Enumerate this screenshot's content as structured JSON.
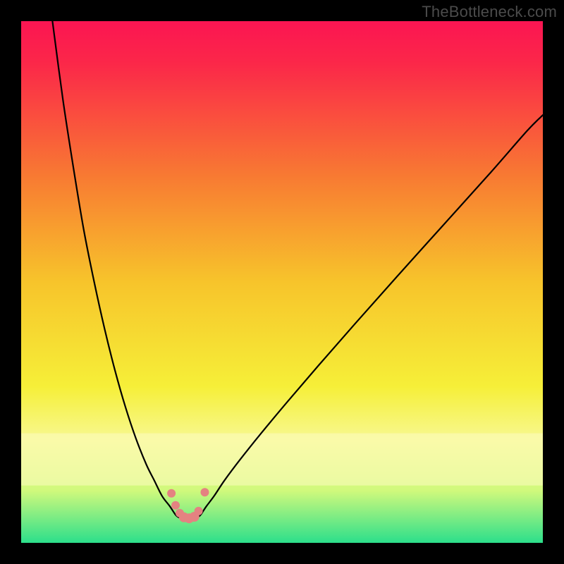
{
  "watermark": "TheBottleneck.com",
  "chart_data": {
    "type": "line",
    "title": "",
    "xlabel": "",
    "ylabel": "",
    "xlim": [
      0,
      100
    ],
    "ylim": [
      0,
      100
    ],
    "grid": false,
    "legend": false,
    "background_gradient": {
      "stops": [
        {
          "offset": 0.0,
          "color": "#fb1552"
        },
        {
          "offset": 0.08,
          "color": "#fb2749"
        },
        {
          "offset": 0.3,
          "color": "#f87b32"
        },
        {
          "offset": 0.5,
          "color": "#f7c42b"
        },
        {
          "offset": 0.7,
          "color": "#f6ef38"
        },
        {
          "offset": 0.8,
          "color": "#f7f88e"
        },
        {
          "offset": 0.9,
          "color": "#d0f97c"
        },
        {
          "offset": 1.0,
          "color": "#2cdf8b"
        }
      ]
    },
    "pale_band": {
      "y0": 79,
      "y1": 89,
      "color": "#fdfcbf"
    },
    "series": [
      {
        "name": "left-arm",
        "type": "line",
        "x": [
          6,
          8,
          10,
          12,
          14,
          16,
          18,
          20,
          22,
          24,
          25.5,
          27,
          28.5,
          29.5,
          30,
          30.5
        ],
        "y": [
          0,
          15,
          28,
          40,
          50,
          59,
          67,
          74,
          80,
          85,
          88,
          91,
          93,
          94.5,
          95,
          95.2
        ]
      },
      {
        "name": "right-arm",
        "type": "line",
        "x": [
          33.5,
          34,
          34.5,
          35.5,
          37,
          39,
          42,
          46,
          51,
          57,
          64,
          72,
          81,
          90,
          97,
          100
        ],
        "y": [
          95.2,
          95,
          94.5,
          93,
          91,
          88,
          84,
          79,
          73,
          66,
          58,
          49,
          39,
          29,
          21,
          18
        ]
      },
      {
        "name": "valley-floor",
        "type": "line",
        "x": [
          30.5,
          31,
          31.8,
          32.6,
          33.2,
          33.5
        ],
        "y": [
          95.2,
          95.4,
          95.5,
          95.5,
          95.4,
          95.2
        ]
      }
    ],
    "markers": {
      "name": "valley-dots",
      "color": "#e48281",
      "points": [
        {
          "x": 28.8,
          "y": 90.5,
          "r": 6
        },
        {
          "x": 29.6,
          "y": 92.8,
          "r": 6
        },
        {
          "x": 30.4,
          "y": 94.3,
          "r": 6
        },
        {
          "x": 31.2,
          "y": 95.1,
          "r": 7
        },
        {
          "x": 32.2,
          "y": 95.3,
          "r": 7
        },
        {
          "x": 33.2,
          "y": 95.0,
          "r": 7
        },
        {
          "x": 34.0,
          "y": 93.9,
          "r": 6
        },
        {
          "x": 35.2,
          "y": 90.3,
          "r": 6
        }
      ]
    }
  }
}
